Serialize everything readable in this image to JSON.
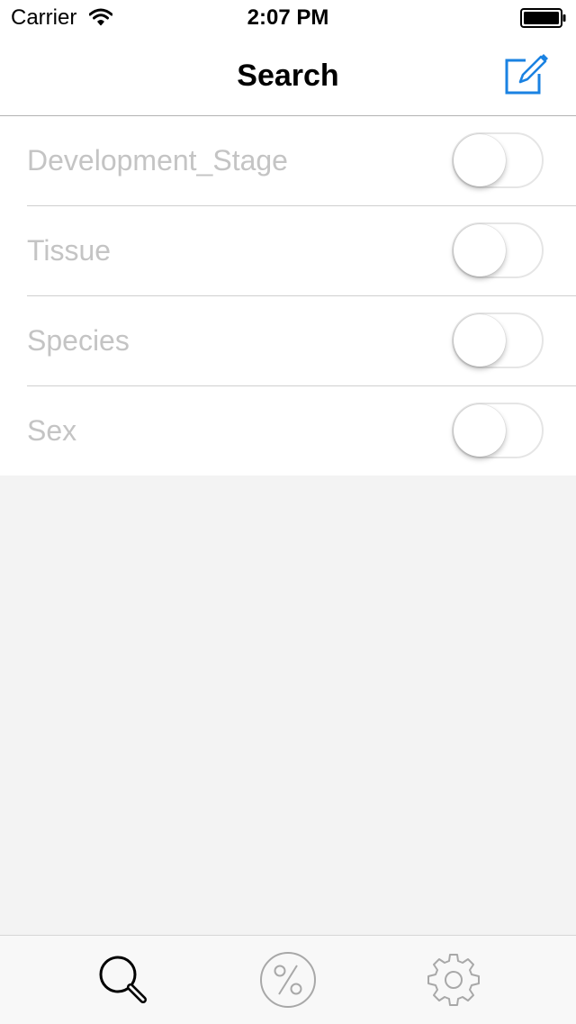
{
  "status_bar": {
    "carrier": "Carrier",
    "time": "2:07 PM",
    "icons": [
      "wifi-icon",
      "battery-icon"
    ]
  },
  "nav": {
    "title": "Search",
    "compose_icon": "compose-icon",
    "accent_color": "#1a82e2"
  },
  "filters": [
    {
      "label": "Development_Stage",
      "enabled": false
    },
    {
      "label": "Tissue",
      "enabled": false
    },
    {
      "label": "Species",
      "enabled": false
    },
    {
      "label": "Sex",
      "enabled": false
    }
  ],
  "tab_bar": {
    "tabs": [
      {
        "icon": "search-icon",
        "selected": true
      },
      {
        "icon": "percent-icon",
        "selected": false
      },
      {
        "icon": "gear-icon",
        "selected": false
      }
    ]
  }
}
